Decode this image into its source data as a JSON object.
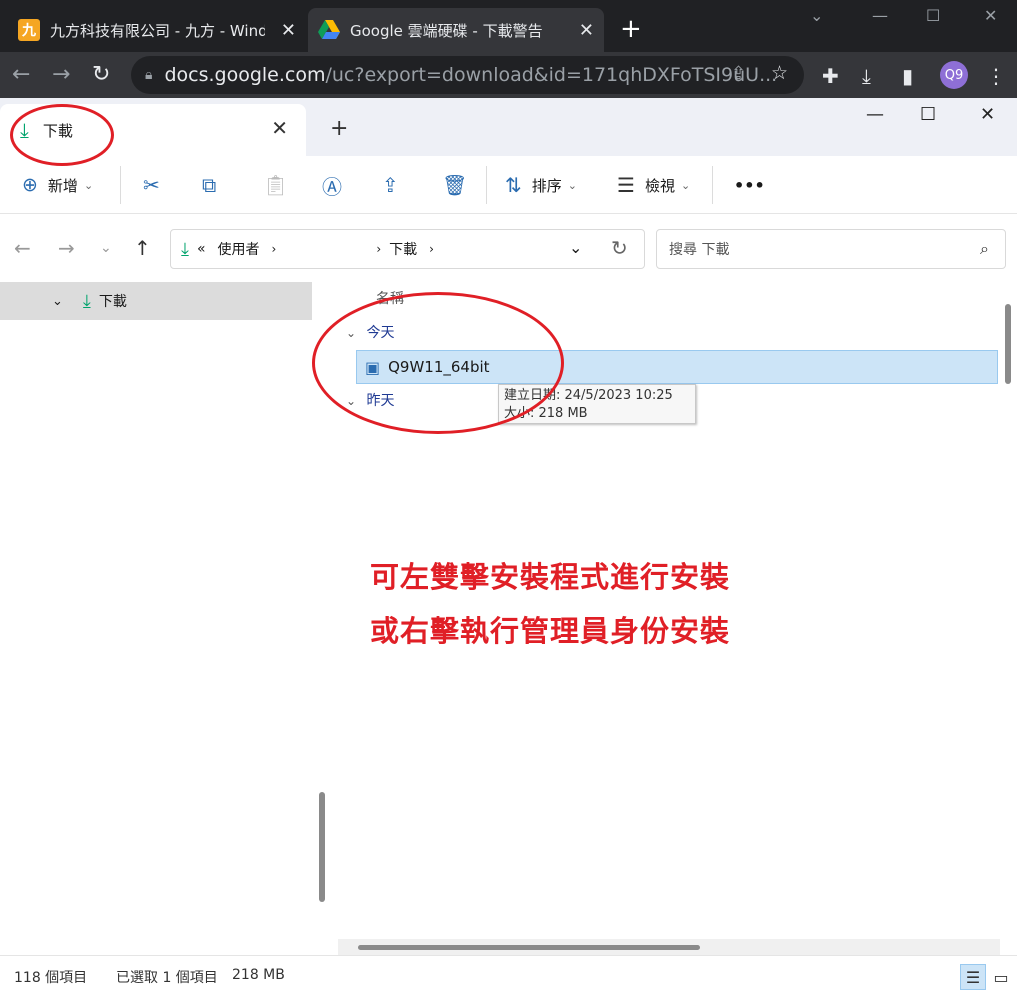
{
  "chrome": {
    "tabs": [
      {
        "favicon": "九",
        "title": "九方科技有限公司 - 九方 - Windows"
      },
      {
        "title": "Google 雲端硬碟 - 下載警告"
      }
    ],
    "new_tab": "+",
    "url_host": "docs.google.com",
    "url_path": "/uc?export=download&id=171qhDXFoTSI9uU...",
    "profile": "Q9"
  },
  "explorer": {
    "tab_title": "下載",
    "commands": {
      "new": "新增",
      "sort": "排序",
      "view": "檢視",
      "more": "•••"
    },
    "address": {
      "overflow": "«",
      "crumb1": "使用者",
      "crumb2": "下載"
    },
    "search_placeholder": "搜尋 下載",
    "nav": {
      "selected": "下載"
    },
    "columns": {
      "name": "名稱"
    },
    "groups": {
      "today": "今天",
      "yesterday": "昨天"
    },
    "file": {
      "name": "Q9W11_64bit"
    },
    "tooltip": {
      "created": "建立日期: 24/5/2023 10:25",
      "size": "大小: 218 MB"
    },
    "status": {
      "count": "118 個項目",
      "selected": "已選取 1 個項目",
      "size": "218 MB"
    }
  },
  "annotation": {
    "line1": "可左雙擊安裝程式進行安裝",
    "line2": "或右擊執行管理員身份安裝"
  },
  "colors": {
    "annotation": "#e01f26",
    "selection": "#cce4f7",
    "accent": "#00a36c"
  }
}
